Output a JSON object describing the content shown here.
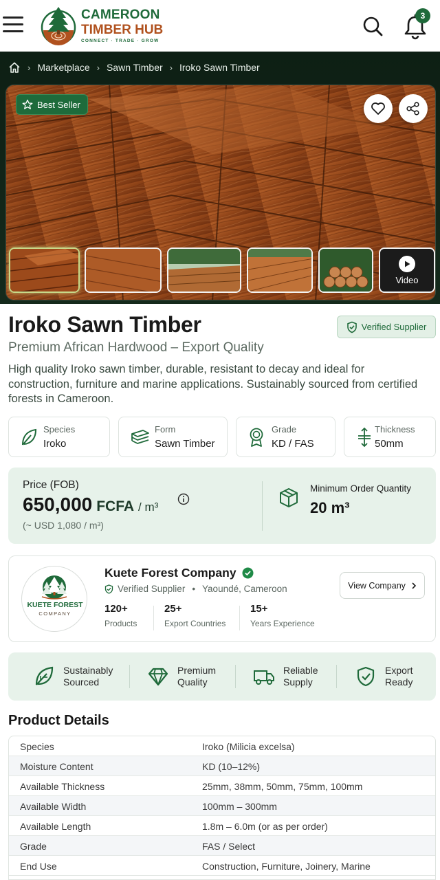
{
  "header": {
    "brand_line1": "CAMEROON",
    "brand_line2": "TIMBER HUB",
    "tagline": "CONNECT · TRADE · GROW",
    "notification_count": "3",
    "icons": [
      "menu-icon",
      "logo-tree-icon",
      "search-icon",
      "bell-icon"
    ],
    "colors": {
      "brand_green": "#1f6a3a",
      "brand_orange": "#b0511e"
    }
  },
  "breadcrumb": [
    "Marketplace",
    "Sawn Timber",
    "Iroko Sawn Timber"
  ],
  "gallery": {
    "badge": "Best Seller",
    "video_label": "Video",
    "thumbnail_count": 6,
    "active_thumbnail": 1
  },
  "product": {
    "title": "Iroko Sawn Timber",
    "verified_label": "Verified Supplier",
    "subtitle": "Premium African Hardwood – Export Quality",
    "description": "High quality Iroko sawn timber, durable, resistant to decay and ideal for construction, furniture and marine applications. Sustainably sourced from certified forests in Cameroon."
  },
  "specs": [
    {
      "label": "Species",
      "value": "Iroko",
      "icon": "leaf-icon"
    },
    {
      "label": "Form",
      "value": "Sawn Timber",
      "icon": "planks-icon"
    },
    {
      "label": "Grade",
      "value": "KD / FAS",
      "icon": "award-icon"
    },
    {
      "label": "Thickness",
      "value": "50mm",
      "icon": "thickness-icon"
    }
  ],
  "price": {
    "label": "Price (FOB)",
    "amount": "650,000",
    "currency": "FCFA",
    "unit": "/ m³",
    "usd": "(~ USD 1,080 / m³)",
    "moq_label": "Minimum Order Quantity",
    "moq_value": "20 m³"
  },
  "supplier": {
    "logo_line1": "KUETE FOREST",
    "logo_line2": "COMPANY",
    "name": "Kuete Forest Company",
    "verified": "Verified Supplier",
    "location": "Yaoundé, Cameroon",
    "view_button": "View Company",
    "stats": [
      {
        "value": "120+",
        "label": "Products"
      },
      {
        "value": "25+",
        "label": "Export Countries"
      },
      {
        "value": "15+",
        "label": "Years Experience"
      }
    ]
  },
  "features": [
    {
      "line1": "Sustainably",
      "line2": "Sourced",
      "icon": "leaf-icon"
    },
    {
      "line1": "Premium",
      "line2": "Quality",
      "icon": "diamond-icon"
    },
    {
      "line1": "Reliable",
      "line2": "Supply",
      "icon": "truck-icon"
    },
    {
      "line1": "Export",
      "line2": "Ready",
      "icon": "shield-check-icon"
    }
  ],
  "details": {
    "heading": "Product Details",
    "rows": [
      {
        "key": "Species",
        "value": "Iroko (Milicia excelsa)"
      },
      {
        "key": "Moisture Content",
        "value": "KD (10–12%)"
      },
      {
        "key": "Available Thickness",
        "value": "25mm, 38mm, 50mm, 75mm, 100mm"
      },
      {
        "key": "Available Width",
        "value": "100mm – 300mm"
      },
      {
        "key": "Available Length",
        "value": "1.8m – 6.0m (or as per order)"
      },
      {
        "key": "Grade",
        "value": "FAS / Select"
      },
      {
        "key": "End Use",
        "value": "Construction, Furniture, Joinery, Marine"
      }
    ]
  }
}
